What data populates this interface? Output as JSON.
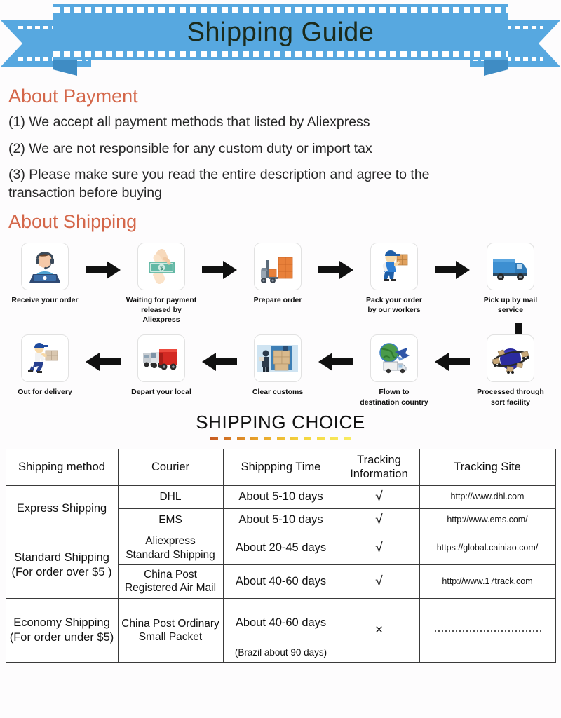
{
  "banner": {
    "title": "Shipping Guide"
  },
  "payment": {
    "heading": "About Payment",
    "items": [
      "(1) We accept all payment methods that listed by Aliexpress",
      "(2) We are not responsible for any custom duty or import tax",
      "(3) Please make sure you read the entire description and agree to the transaction before buying"
    ]
  },
  "shipping": {
    "heading": "About Shipping",
    "row1": [
      {
        "icon": "support-agent-icon",
        "label": "Receive your order"
      },
      {
        "icon": "money-exchange-icon",
        "label": "Waiting for payment\nreleased by Aliexpress"
      },
      {
        "icon": "forklift-boxes-icon",
        "label": "Prepare order"
      },
      {
        "icon": "worker-package-icon",
        "label": "Pack your order\nby our workers"
      },
      {
        "icon": "blue-truck-icon",
        "label": "Pick up by mail service"
      }
    ],
    "row2": [
      {
        "icon": "delivery-person-icon",
        "label": "Out for delivery"
      },
      {
        "icon": "red-truck-fleet-icon",
        "label": "Depart your local"
      },
      {
        "icon": "customs-officer-icon",
        "label": "Clear customs"
      },
      {
        "icon": "globe-plane-icon",
        "label": "Flown to\ndestination country"
      },
      {
        "icon": "sort-facility-globe-icon",
        "label": "Processed through\nsort facility"
      }
    ]
  },
  "choice": {
    "title": "SHIPPING CHOICE"
  },
  "table": {
    "headers": [
      "Shipping method",
      "Courier",
      "Shippping Time",
      "Tracking\nInformation",
      "Tracking Site"
    ],
    "rows": [
      {
        "method": "Express Shipping",
        "method_rowspan": 2,
        "courier": "DHL",
        "time": "About 5-10 days",
        "time_sub": "",
        "tracking": "√",
        "site": "http://www.dhl.com"
      },
      {
        "method": "",
        "courier": "EMS",
        "time": "About 5-10 days",
        "time_sub": "",
        "tracking": "√",
        "site": "http://www.ems.com/"
      },
      {
        "method": "Standard Shipping\n(For order over $5 )",
        "method_rowspan": 2,
        "courier": "Aliexpress\nStandard Shipping",
        "time": "About 20-45 days",
        "time_sub": "",
        "tracking": "√",
        "site": "https://global.cainiao.com/"
      },
      {
        "method": "",
        "courier": "China Post\nRegistered Air Mail",
        "time": "About 40-60 days",
        "time_sub": "",
        "tracking": "√",
        "site": "http://www.17track.com"
      },
      {
        "method": "Economy Shipping\n(For order under $5)",
        "method_rowspan": 1,
        "courier": "China Post Ordinary\nSmall Packet",
        "time": "About 40-60 days",
        "time_sub": "(Brazil about 90 days)",
        "tracking": "×",
        "site": ""
      }
    ]
  },
  "colors": {
    "banner_blue": "#57a8e0",
    "banner_blue_dark": "#3f8cc4",
    "heading_orange": "#d4674a",
    "text_dark": "#262626",
    "table_border": "#3a3a3a"
  }
}
